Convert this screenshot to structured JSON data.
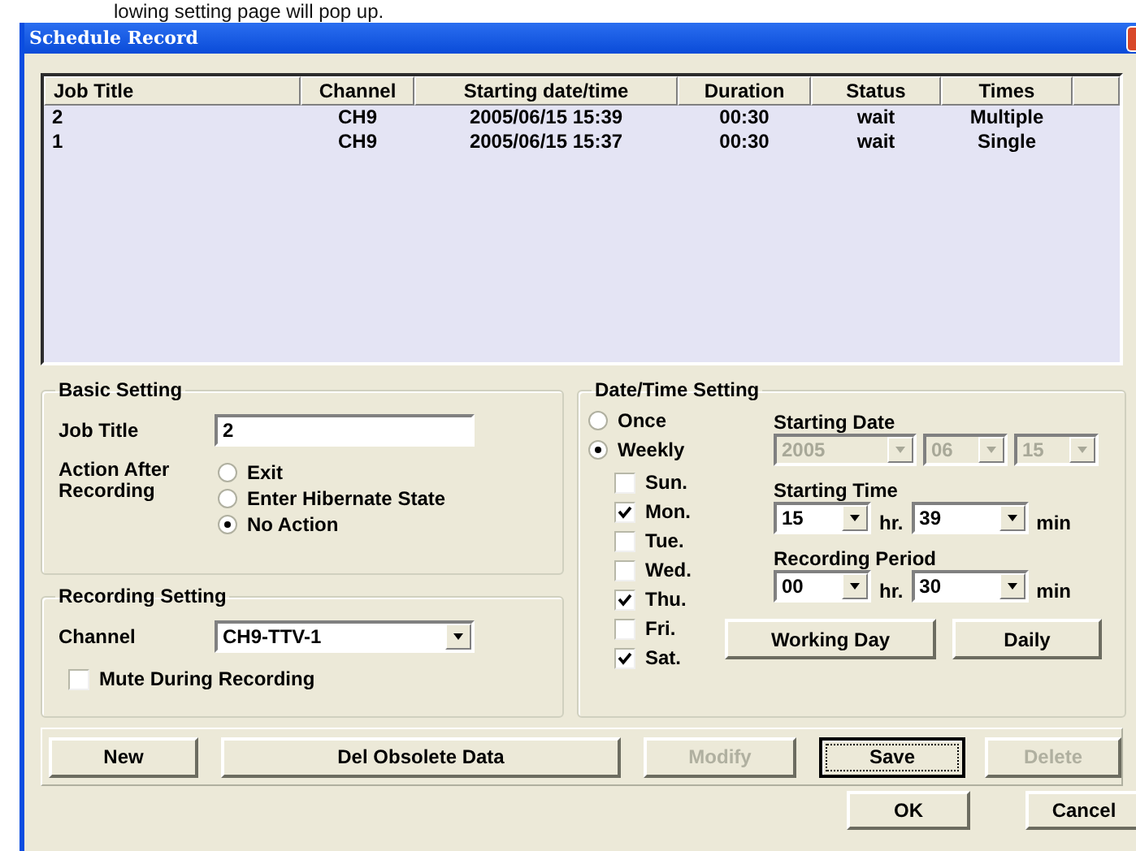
{
  "doc_caption": "lowing setting page will pop up.",
  "window": {
    "title": "Schedule Record"
  },
  "table": {
    "columns": [
      "Job Title",
      "Channel",
      "Starting date/time",
      "Duration",
      "Status",
      "Times"
    ],
    "rows": [
      [
        "2",
        "CH9",
        "2005/06/15 15:39",
        "00:30",
        "wait",
        "Multiple"
      ],
      [
        "1",
        "CH9",
        "2005/06/15 15:37",
        "00:30",
        "wait",
        "Single"
      ]
    ]
  },
  "basic_setting": {
    "title": "Basic Setting",
    "job_title_label": "Job Title",
    "job_title_value": "2",
    "action_label": "Action After Recording",
    "actions": [
      {
        "label": "Exit",
        "selected": false
      },
      {
        "label": "Enter Hibernate State",
        "selected": false
      },
      {
        "label": "No Action",
        "selected": true
      }
    ]
  },
  "recording_setting": {
    "title": "Recording Setting",
    "channel_label": "Channel",
    "channel_value": "CH9-TTV-1",
    "mute": {
      "label": "Mute During Recording",
      "checked": false
    }
  },
  "datetime_setting": {
    "title": "Date/Time Setting",
    "modes": [
      {
        "label": "Once",
        "selected": false
      },
      {
        "label": "Weekly",
        "selected": true
      }
    ],
    "days": [
      {
        "label": "Sun.",
        "checked": false
      },
      {
        "label": "Mon.",
        "checked": true
      },
      {
        "label": "Tue.",
        "checked": false
      },
      {
        "label": "Wed.",
        "checked": false
      },
      {
        "label": "Thu.",
        "checked": true
      },
      {
        "label": "Fri.",
        "checked": false
      },
      {
        "label": "Sat.",
        "checked": true
      }
    ],
    "starting_date": {
      "label": "Starting Date",
      "disabled": true,
      "fields": [
        "2005",
        "06",
        "15"
      ]
    },
    "starting_time": {
      "label": "Starting Time",
      "hour": "15",
      "hour_unit": "hr.",
      "minute": "39",
      "minute_unit": "min"
    },
    "recording_period": {
      "label": "Recording Period",
      "hour": "00",
      "hour_unit": "hr.",
      "minute": "30",
      "minute_unit": "min"
    },
    "buttons": [
      "Working Day",
      "Daily"
    ]
  },
  "actions": [
    {
      "label": "New",
      "disabled": false,
      "focused": false
    },
    {
      "label": "Del Obsolete Data",
      "disabled": false,
      "focused": false
    },
    {
      "label": "Modify",
      "disabled": true,
      "focused": false
    },
    {
      "label": "Save",
      "disabled": false,
      "focused": true
    },
    {
      "label": "Delete",
      "disabled": true,
      "focused": false
    }
  ],
  "dialog_buttons": [
    "OK",
    "Cancel"
  ]
}
